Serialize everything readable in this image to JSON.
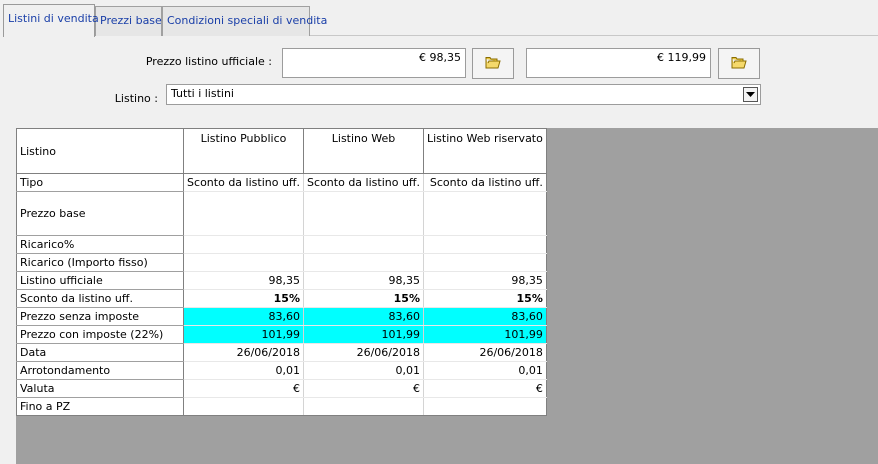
{
  "tabs": [
    {
      "label": "Listini di vendita",
      "active": true
    },
    {
      "label": "Prezzi base",
      "active": false
    },
    {
      "label": "Condizioni speciali di vendita",
      "active": false
    }
  ],
  "form": {
    "prezzo_label": "Prezzo listino ufficiale :",
    "prezzo_1": "€ 98,35",
    "prezzo_2": "€ 119,99",
    "listino_label": "Listino :",
    "listino_value": "Tutti i listini"
  },
  "grid": {
    "corner": "Listino",
    "columns": [
      "Listino Pubblico",
      "Listino Web",
      "Listino Web riservato"
    ],
    "rows": [
      {
        "label": "Tipo",
        "values": [
          "Sconto da listino uff.",
          "Sconto da listino uff.",
          "Sconto da listino uff."
        ]
      },
      {
        "label": "Prezzo base",
        "values": [
          "",
          "",
          ""
        ]
      },
      {
        "label": "Ricarico%",
        "values": [
          "",
          "",
          ""
        ]
      },
      {
        "label": "Ricarico (Importo fisso)",
        "values": [
          "",
          "",
          ""
        ]
      },
      {
        "label": "Listino ufficiale",
        "values": [
          "98,35",
          "98,35",
          "98,35"
        ]
      },
      {
        "label": "Sconto da listino uff.",
        "values": [
          "15%",
          "15%",
          "15%"
        ]
      },
      {
        "label": "Prezzo senza imposte",
        "values": [
          "83,60",
          "83,60",
          "83,60"
        ]
      },
      {
        "label": "Prezzo con imposte (22%)",
        "values": [
          "101,99",
          "101,99",
          "101,99"
        ]
      },
      {
        "label": "Data",
        "values": [
          "26/06/2018",
          "26/06/2018",
          "26/06/2018"
        ]
      },
      {
        "label": "Arrotondamento",
        "values": [
          "0,01",
          "0,01",
          "0,01"
        ]
      },
      {
        "label": "Valuta",
        "values": [
          "€",
          "€",
          "€"
        ]
      },
      {
        "label": "Fino a PZ",
        "values": [
          "",
          "",
          ""
        ]
      }
    ]
  },
  "colors": {
    "highlight": "#00ffff",
    "tab_text": "#1a3fa8",
    "background_gray": "#a0a0a0"
  },
  "icons": {
    "price_buttons": "folder-icon",
    "combo_arrow": "chevron-down-icon"
  }
}
